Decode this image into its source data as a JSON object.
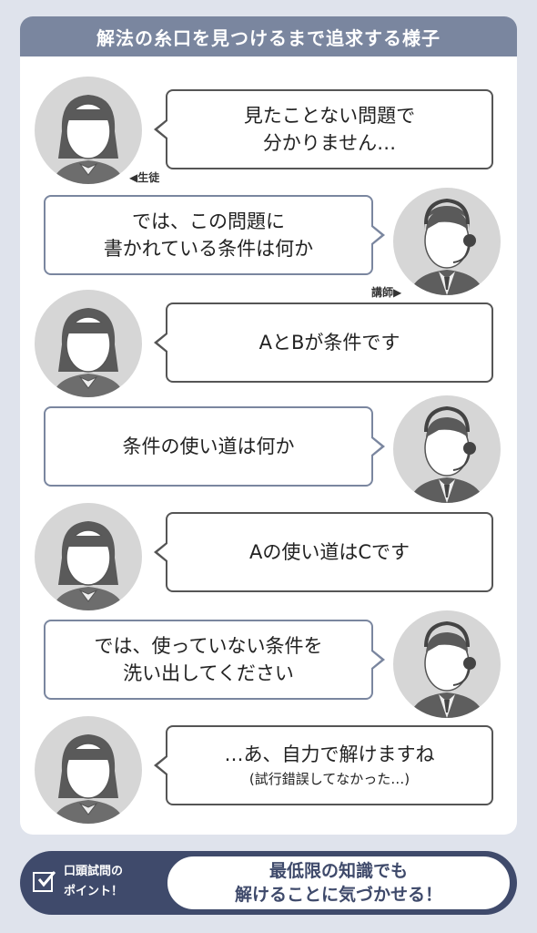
{
  "header": {
    "title": "解法の糸口を見つけるまで追求する様子"
  },
  "roles": {
    "student": "◀生徒",
    "teacher": "講師▶"
  },
  "dialogue": [
    {
      "speaker": "student",
      "lines": [
        "見たことない問題で",
        "分かりません…"
      ]
    },
    {
      "speaker": "teacher",
      "lines": [
        "では、この問題に",
        "書かれている条件は何か"
      ]
    },
    {
      "speaker": "student",
      "lines": [
        "AとBが条件です"
      ]
    },
    {
      "speaker": "teacher",
      "lines": [
        "条件の使い道は何か"
      ]
    },
    {
      "speaker": "student",
      "lines": [
        "Aの使い道はCです"
      ]
    },
    {
      "speaker": "teacher",
      "lines": [
        "では、使っていない条件を",
        "洗い出してください"
      ]
    },
    {
      "speaker": "student",
      "lines": [
        "…あ、自力で解けますね"
      ],
      "note": "(試行錯誤してなかった…)"
    }
  ],
  "footer": {
    "label_lines": [
      "口頭試問の",
      "ポイント！"
    ],
    "message_lines": [
      "最低限の知識でも",
      "解けることに気づかせる！"
    ]
  },
  "icons": {
    "check": "checkbox-check-icon"
  },
  "colors": {
    "accent": "#7a869f",
    "footer": "#3f4a6b",
    "background": "#dfe3ec"
  }
}
